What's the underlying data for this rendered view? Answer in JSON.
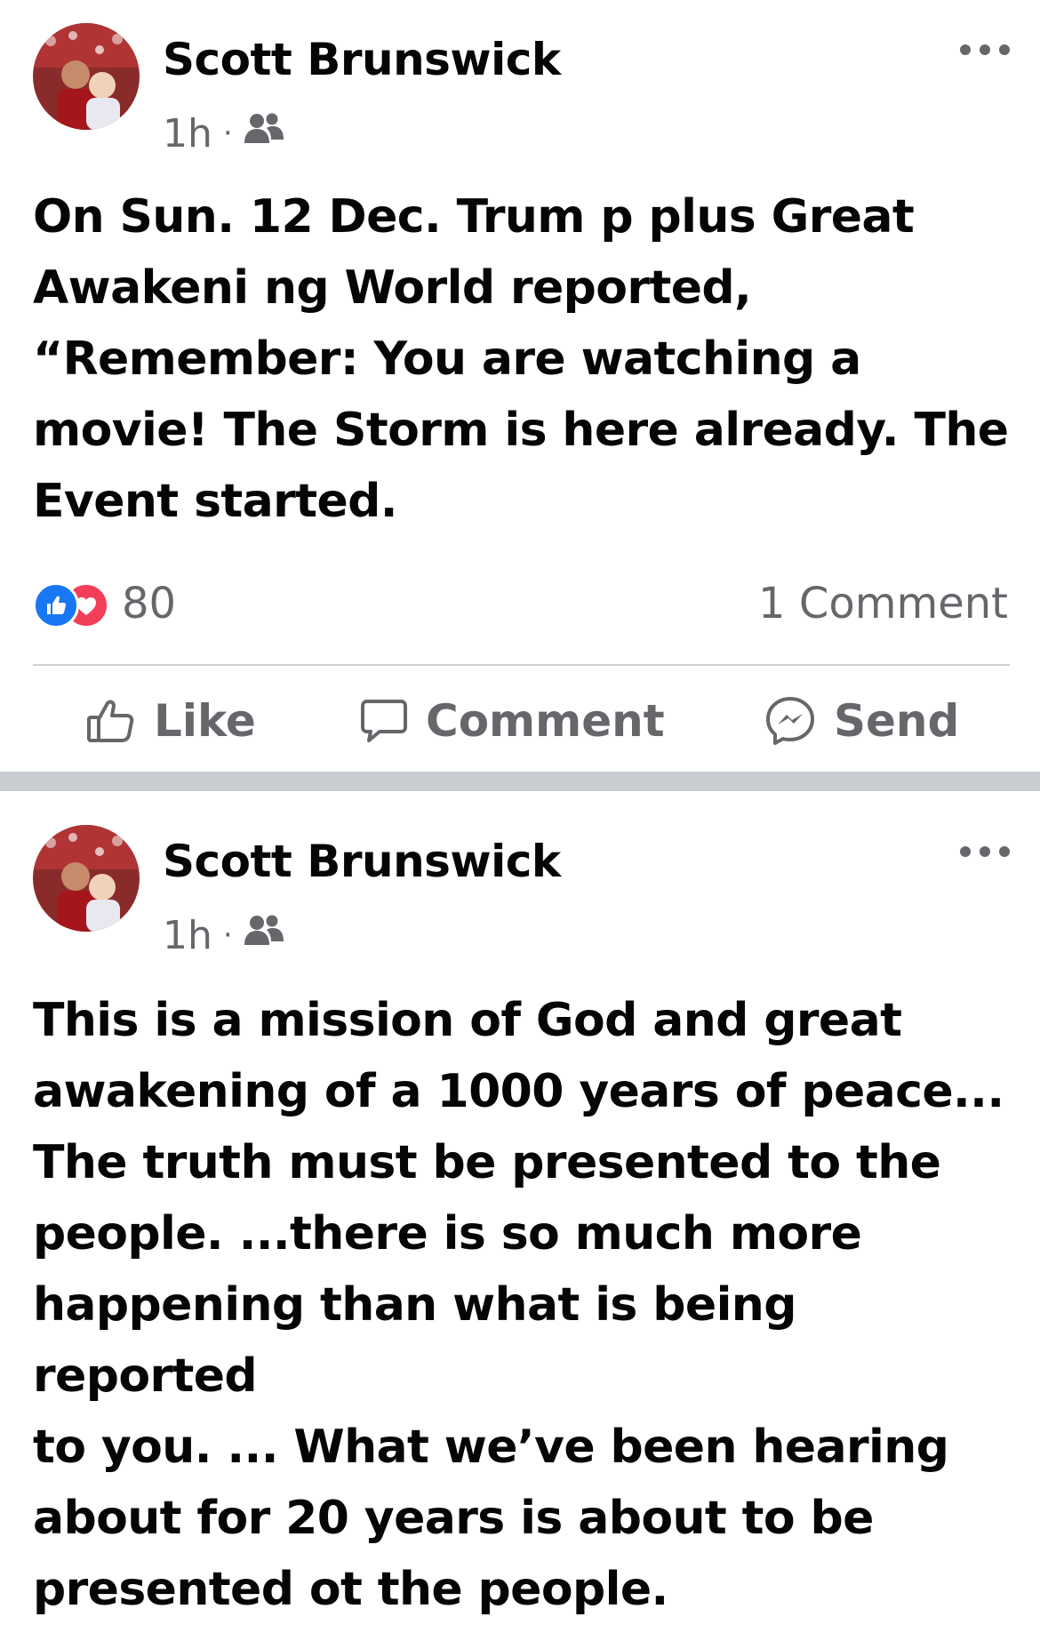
{
  "posts": [
    {
      "author": "Scott Brunswick",
      "time": "1h",
      "separator": "·",
      "audience_icon": "friends-icon",
      "text": "On Sun. 12 Dec. Trum p plus Great\nAwakeni ng World reported,\n“Remember: You are watching a\nmovie! The Storm is here already. The\nEvent started.",
      "reaction_count": "80",
      "comment_count": "1 Comment",
      "actions": {
        "like": "Like",
        "comment": "Comment",
        "send": "Send"
      }
    },
    {
      "author": "Scott Brunswick",
      "time": "1h",
      "separator": "·",
      "audience_icon": "friends-icon",
      "text": "This is a mission of God and great\nawakening of a 1000 years of peace...\nThe truth must be presented to the\npeople. ...there is so much more\nhappening than what is being reported\nto you. ... What we’ve been hearing\nabout for 20 years is about to be\npresented ot the people."
    }
  ],
  "colors": {
    "like_blue": "#1877f2",
    "love_red": "#f33e58",
    "secondary_text": "#65676b",
    "primary_text": "#050505",
    "feed_separator": "#c9ccd1"
  }
}
